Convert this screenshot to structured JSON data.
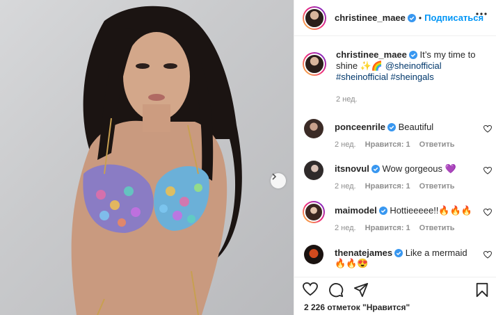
{
  "post": {
    "username": "christinee_maee",
    "follow_label": "Подписаться",
    "separator": "•"
  },
  "caption": {
    "username": "christinee_maee",
    "text": "It’s my time to shine ✨🌈",
    "mention": "@sheinofficial",
    "hashtags": "#sheinofficial #sheingals",
    "time": "2 нед."
  },
  "comments": [
    {
      "username": "ponceenrile",
      "text": "Beautiful",
      "time": "2 нед.",
      "likes": "Нравится: 1",
      "reply": "Ответить"
    },
    {
      "username": "itsnovul",
      "text": "Wow gorgeous 💜",
      "time": "2 нед.",
      "likes": "Нравится: 1",
      "reply": "Ответить"
    },
    {
      "username": "maimodel",
      "text": "Hottieeeee!!🔥🔥🔥",
      "time": "2 нед.",
      "likes": "Нравится: 1",
      "reply": "Ответить"
    },
    {
      "username": "thenatejames",
      "text": "Like a mermaid",
      "text2": "🔥🔥😍"
    }
  ],
  "likes_text": "2 226 отметок \"Нравится\"",
  "colors": {
    "link": "#00376b",
    "follow": "#0095f6",
    "verified": "#3897f0",
    "muted": "#8e8e8e"
  },
  "icons": [
    "verified-badge-icon",
    "more-options-icon",
    "heart-icon",
    "comment-icon",
    "share-icon",
    "bookmark-icon",
    "chevron-right-icon"
  ]
}
